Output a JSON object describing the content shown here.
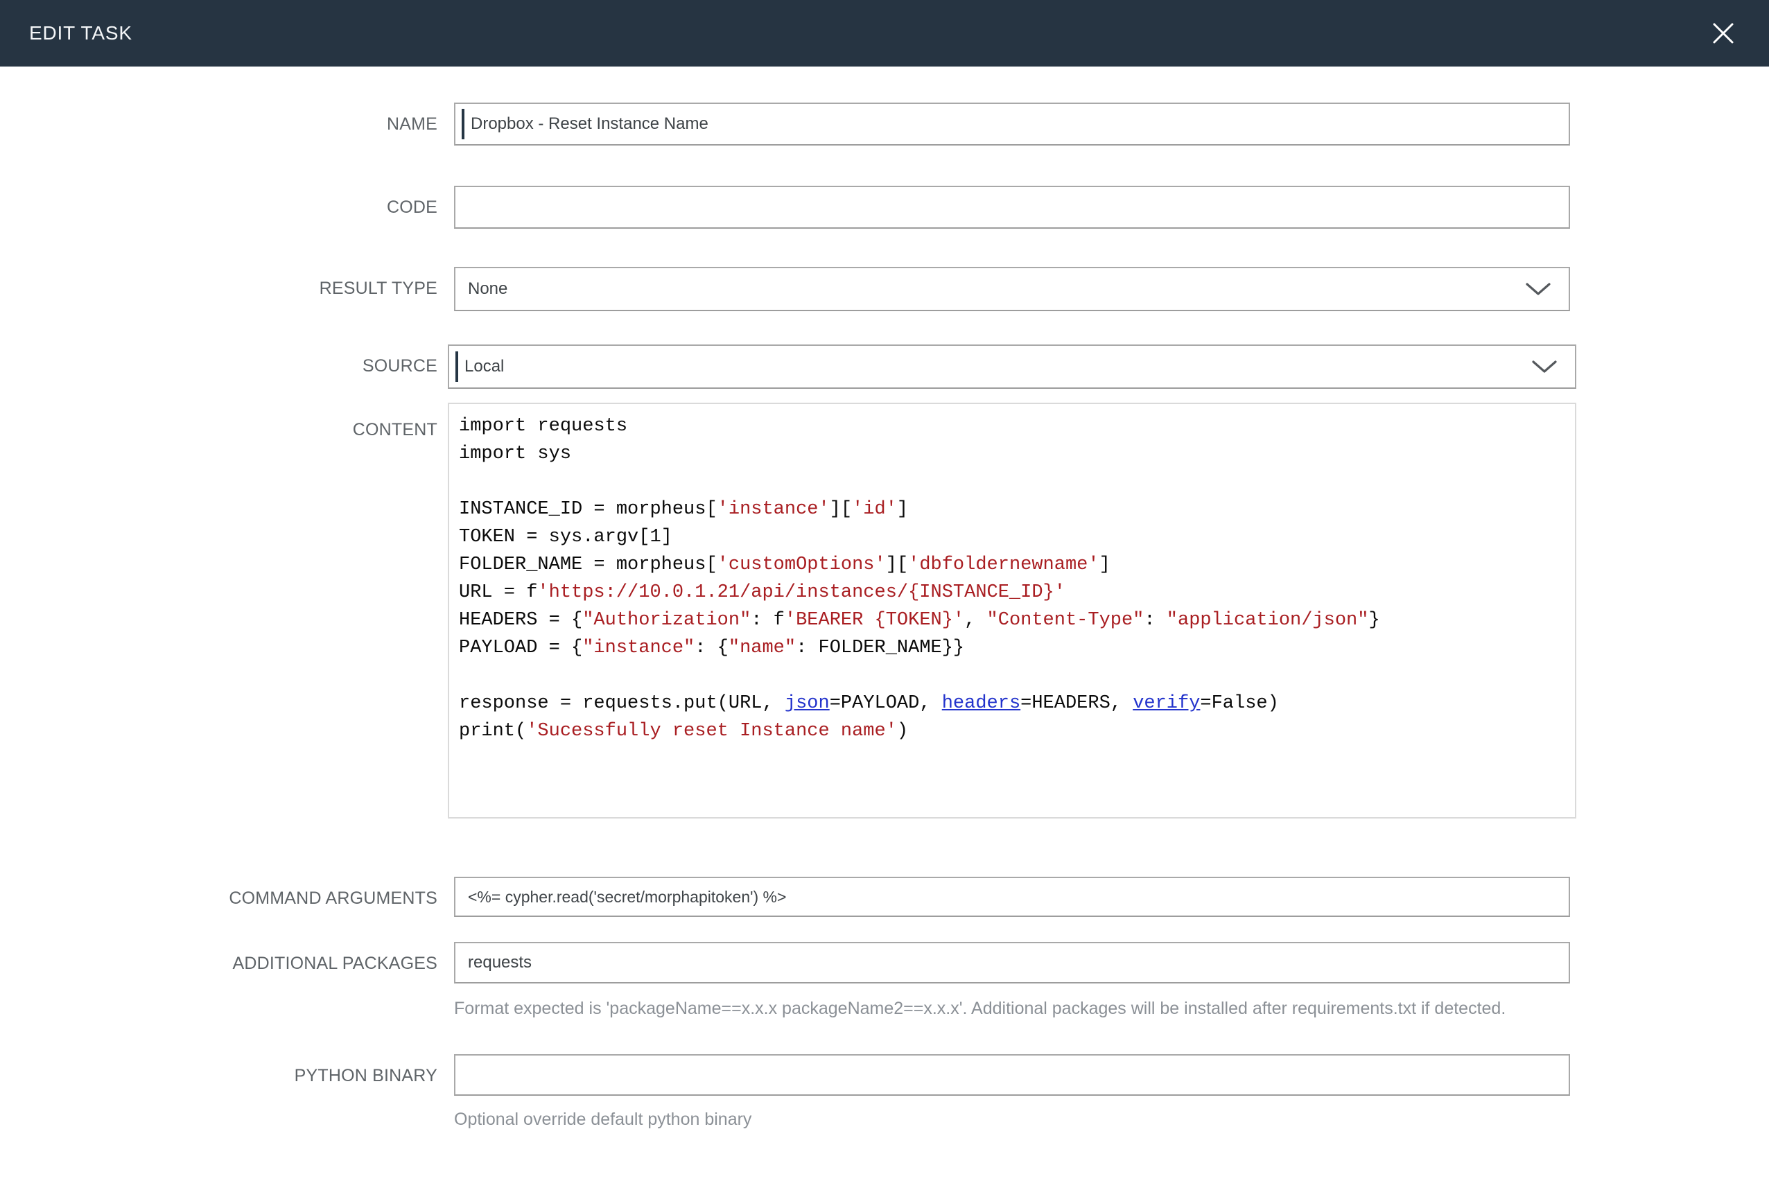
{
  "header": {
    "title": "EDIT TASK"
  },
  "form": {
    "name": {
      "label": "NAME",
      "value": "Dropbox - Reset Instance Name"
    },
    "code": {
      "label": "CODE",
      "value": ""
    },
    "result_type": {
      "label": "RESULT TYPE",
      "value": "None"
    },
    "source": {
      "label": "SOURCE",
      "value": "Local"
    },
    "content": {
      "label": "CONTENT",
      "lines": [
        [
          {
            "c": "p",
            "t": "import requests"
          }
        ],
        [
          {
            "c": "p",
            "t": "import sys"
          }
        ],
        [],
        [
          {
            "c": "p",
            "t": "INSTANCE_ID = morpheus["
          },
          {
            "c": "s",
            "t": "'instance'"
          },
          {
            "c": "p",
            "t": "]["
          },
          {
            "c": "s",
            "t": "'id'"
          },
          {
            "c": "p",
            "t": "]"
          }
        ],
        [
          {
            "c": "p",
            "t": "TOKEN = sys.argv[1]"
          }
        ],
        [
          {
            "c": "p",
            "t": "FOLDER_NAME = morpheus["
          },
          {
            "c": "s",
            "t": "'customOptions'"
          },
          {
            "c": "p",
            "t": "]["
          },
          {
            "c": "s",
            "t": "'dbfoldernewname'"
          },
          {
            "c": "p",
            "t": "]"
          }
        ],
        [
          {
            "c": "p",
            "t": "URL = f"
          },
          {
            "c": "s",
            "t": "'https://10.0.1.21/api/instances/{INSTANCE_ID}'"
          }
        ],
        [
          {
            "c": "p",
            "t": "HEADERS = {"
          },
          {
            "c": "s",
            "t": "\"Authorization\""
          },
          {
            "c": "p",
            "t": ": f"
          },
          {
            "c": "s",
            "t": "'BEARER {TOKEN}'"
          },
          {
            "c": "p",
            "t": ", "
          },
          {
            "c": "s",
            "t": "\"Content-Type\""
          },
          {
            "c": "p",
            "t": ": "
          },
          {
            "c": "s",
            "t": "\"application/json\""
          },
          {
            "c": "p",
            "t": "}"
          }
        ],
        [
          {
            "c": "p",
            "t": "PAYLOAD = {"
          },
          {
            "c": "s",
            "t": "\"instance\""
          },
          {
            "c": "p",
            "t": ": {"
          },
          {
            "c": "s",
            "t": "\"name\""
          },
          {
            "c": "p",
            "t": ": FOLDER_NAME}}"
          }
        ],
        [],
        [
          {
            "c": "p",
            "t": "response = requests.put(URL, "
          },
          {
            "c": "k",
            "t": "json"
          },
          {
            "c": "p",
            "t": "=PAYLOAD, "
          },
          {
            "c": "k",
            "t": "headers"
          },
          {
            "c": "p",
            "t": "=HEADERS, "
          },
          {
            "c": "k",
            "t": "verify"
          },
          {
            "c": "p",
            "t": "=False)"
          }
        ],
        [
          {
            "c": "p",
            "t": "print("
          },
          {
            "c": "s",
            "t": "'Sucessfully reset Instance name'"
          },
          {
            "c": "p",
            "t": ")"
          }
        ]
      ]
    },
    "command_arguments": {
      "label": "COMMAND ARGUMENTS",
      "value": "<%= cypher.read('secret/morphapitoken') %>"
    },
    "additional_packages": {
      "label": "ADDITIONAL PACKAGES",
      "value": "requests",
      "help": "Format expected is 'packageName==x.x.x packageName2==x.x.x'. Additional packages will be installed after requirements.txt if detected."
    },
    "python_binary": {
      "label": "PYTHON BINARY",
      "value": "",
      "help": "Optional override default python binary"
    }
  },
  "colors": {
    "header_bg": "#263442",
    "code_string": "#a91e22",
    "code_kwarg": "#2333cc",
    "cursor_bar": "#253544",
    "input_border": "#a9a9a9"
  }
}
